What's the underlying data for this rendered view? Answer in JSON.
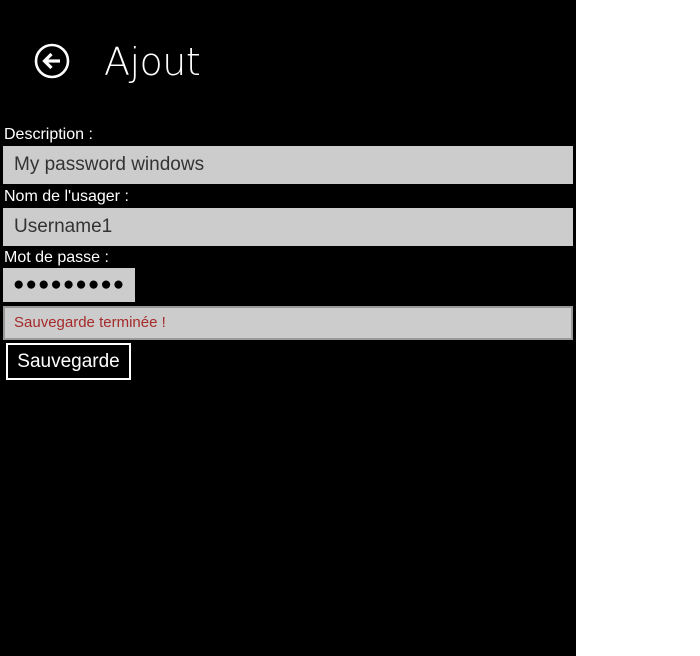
{
  "header": {
    "back_icon": "back-arrow-circle-icon",
    "title": "Ajout"
  },
  "form": {
    "description": {
      "label": "Description :",
      "value": "My password windows"
    },
    "username": {
      "label": "Nom de l'usager :",
      "value": "Username1"
    },
    "password": {
      "label": "Mot de passe :",
      "masked_value": "●●●●●●●●●"
    },
    "status_message": "Sauvegarde terminée !",
    "save_label": "Sauvegarde"
  },
  "colors": {
    "background": "#000000",
    "input_background": "#cccccc",
    "status_text": "#a52a2a",
    "outside_background": "#ffffff"
  }
}
